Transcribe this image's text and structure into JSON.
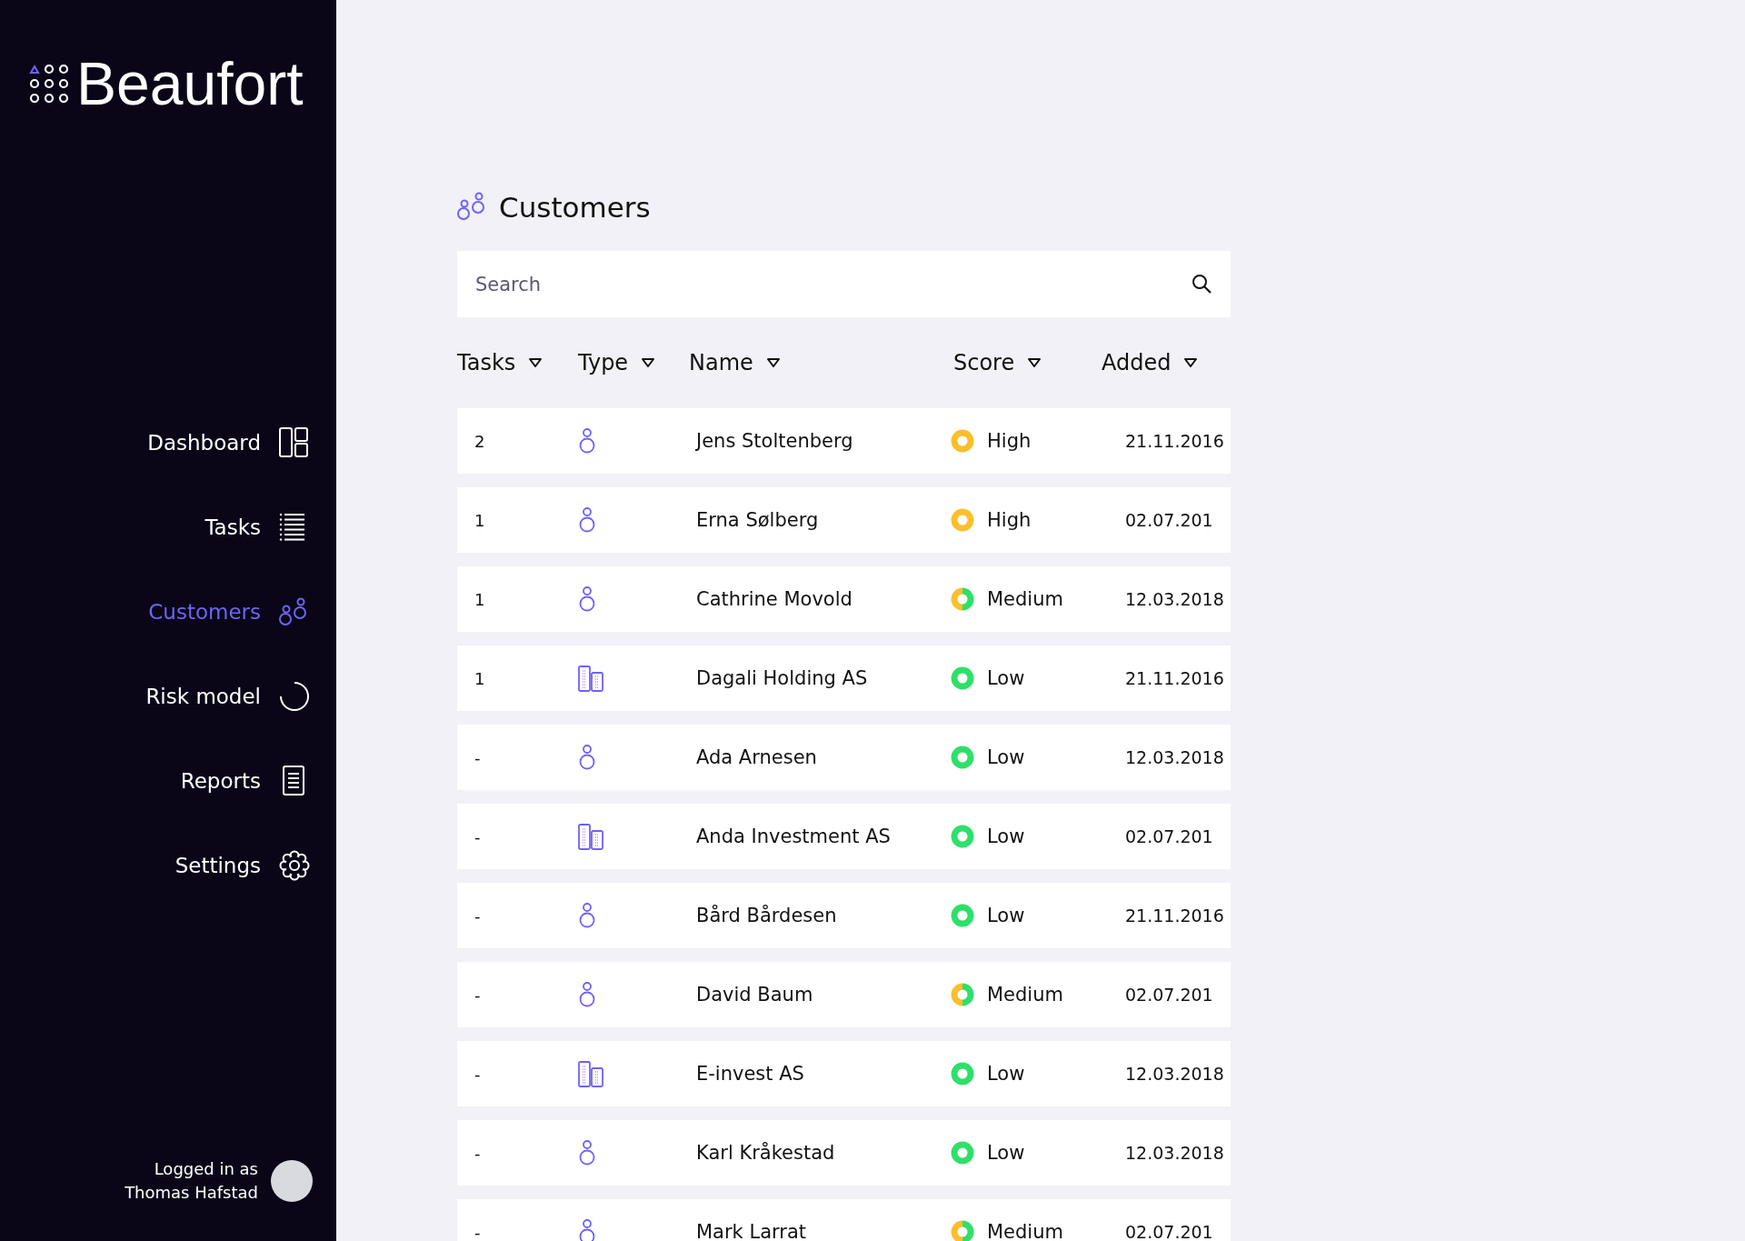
{
  "brand": {
    "name": "Beaufort"
  },
  "nav": [
    {
      "label": "Dashboard",
      "kind": "dashboard",
      "selected": false
    },
    {
      "label": "Tasks",
      "kind": "list",
      "selected": false
    },
    {
      "label": "Customers",
      "kind": "customers",
      "selected": true
    },
    {
      "label": "Risk model",
      "kind": "arc",
      "selected": false
    },
    {
      "label": "Reports",
      "kind": "document",
      "selected": false
    },
    {
      "label": "Settings",
      "kind": "settings",
      "selected": false
    }
  ],
  "user": {
    "caption": "Logged in as",
    "name": "Thomas Hafstad"
  },
  "page": {
    "title": "Customers"
  },
  "search": {
    "placeholder": "Search"
  },
  "table": {
    "columns": [
      "Tasks",
      "Type",
      "Name",
      "Score",
      "Added"
    ],
    "rows": [
      {
        "tasks": "2",
        "kind": "person",
        "name": "Jens Stoltenberg",
        "score": {
          "kind": "high",
          "label": "High"
        },
        "added": "21.11.2016"
      },
      {
        "tasks": "1",
        "kind": "person",
        "name": "Erna Sølberg",
        "score": {
          "kind": "high",
          "label": "High"
        },
        "added": "02.07.201"
      },
      {
        "tasks": "1",
        "kind": "person",
        "name": "Cathrine Movold",
        "score": {
          "kind": "medium",
          "label": "Medium"
        },
        "added": "12.03.2018"
      },
      {
        "tasks": "1",
        "kind": "company",
        "name": "Dagali Holding AS",
        "score": {
          "kind": "low",
          "label": "Low"
        },
        "added": "21.11.2016"
      },
      {
        "tasks": "-",
        "kind": "person",
        "name": "Ada Arnesen",
        "score": {
          "kind": "low",
          "label": "Low"
        },
        "added": "12.03.2018"
      },
      {
        "tasks": "-",
        "kind": "company",
        "name": "Anda Investment AS",
        "score": {
          "kind": "low",
          "label": "Low"
        },
        "added": "02.07.201"
      },
      {
        "tasks": "-",
        "kind": "person",
        "name": "Bård Bårdesen",
        "score": {
          "kind": "low",
          "label": "Low"
        },
        "added": "21.11.2016"
      },
      {
        "tasks": "-",
        "kind": "person",
        "name": "David Baum",
        "score": {
          "kind": "medium",
          "label": "Medium"
        },
        "added": "02.07.201"
      },
      {
        "tasks": "-",
        "kind": "company",
        "name": "E-invest AS",
        "score": {
          "kind": "low",
          "label": "Low"
        },
        "added": "12.03.2018"
      },
      {
        "tasks": "-",
        "kind": "person",
        "name": "Karl Kråkestad",
        "score": {
          "kind": "low",
          "label": "Low"
        },
        "added": "12.03.2018"
      },
      {
        "tasks": "-",
        "kind": "person",
        "name": "Mark Larrat",
        "score": {
          "kind": "medium",
          "label": "Medium"
        },
        "added": "02.07.201"
      }
    ]
  }
}
